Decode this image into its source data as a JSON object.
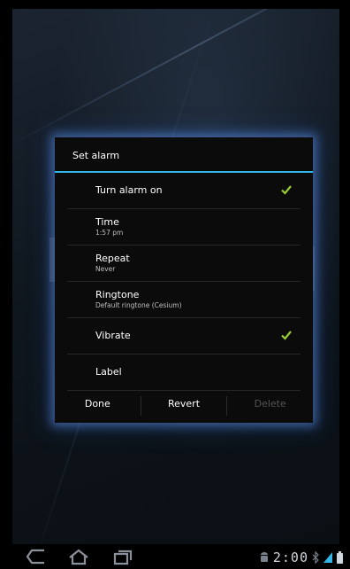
{
  "dialog": {
    "title": "Set alarm",
    "items": [
      {
        "label": "Turn alarm on",
        "checked": true
      },
      {
        "label": "Time",
        "sublabel": "1:57 pm"
      },
      {
        "label": "Repeat",
        "sublabel": "Never"
      },
      {
        "label": "Ringtone",
        "sublabel": "Default ringtone (Cesium)"
      },
      {
        "label": "Vibrate",
        "checked": true
      },
      {
        "label": "Label"
      }
    ],
    "buttons": {
      "done": "Done",
      "revert": "Revert",
      "delete": "Delete"
    }
  },
  "status": {
    "time": "2:00"
  },
  "icons": {
    "nav": [
      "back-icon",
      "home-icon",
      "recent-apps-icon"
    ],
    "status": [
      "android-icon",
      "bluetooth-icon",
      "signal-icon",
      "battery-icon"
    ]
  },
  "colors": {
    "accent": "#33b5e5",
    "check": "#9acd32",
    "glow": "#5a8cdc"
  }
}
